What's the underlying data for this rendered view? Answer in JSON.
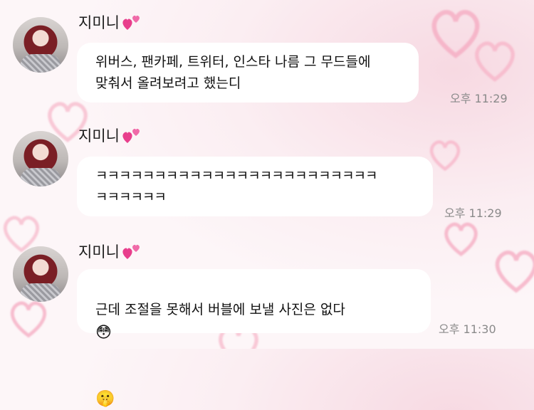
{
  "messages": [
    {
      "sender": "지미니",
      "text": "위버스, 팬카페, 트위터, 인스타 나름 그 무드들에\n맞춰서 올려보려고 했는디",
      "time": "오후 11:29"
    },
    {
      "sender": "지미니",
      "text": "ㅋㅋㅋㅋㅋㅋㅋㅋㅋㅋㅋㅋㅋㅋㅋㅋㅋㅋㅋㅋㅋㅋㅋㅋ\nㅋㅋㅋㅋㅋㅋ",
      "time": "오후 11:29"
    },
    {
      "sender": "지미니",
      "text": "근데 조절을 못해서 버블에 보낼 사진은 없다",
      "emoji_flushed": "😳",
      "emoji_shush": "🤫",
      "time": "오후 11:30"
    }
  ],
  "colors": {
    "bubble": "#ffffff",
    "name_heart": "#e83e8c",
    "background": "#fbeef2",
    "time_text": "#8a8a8a"
  },
  "icons": {
    "name_badge": "two-hearts-icon",
    "background": "heart-outline-icon"
  }
}
